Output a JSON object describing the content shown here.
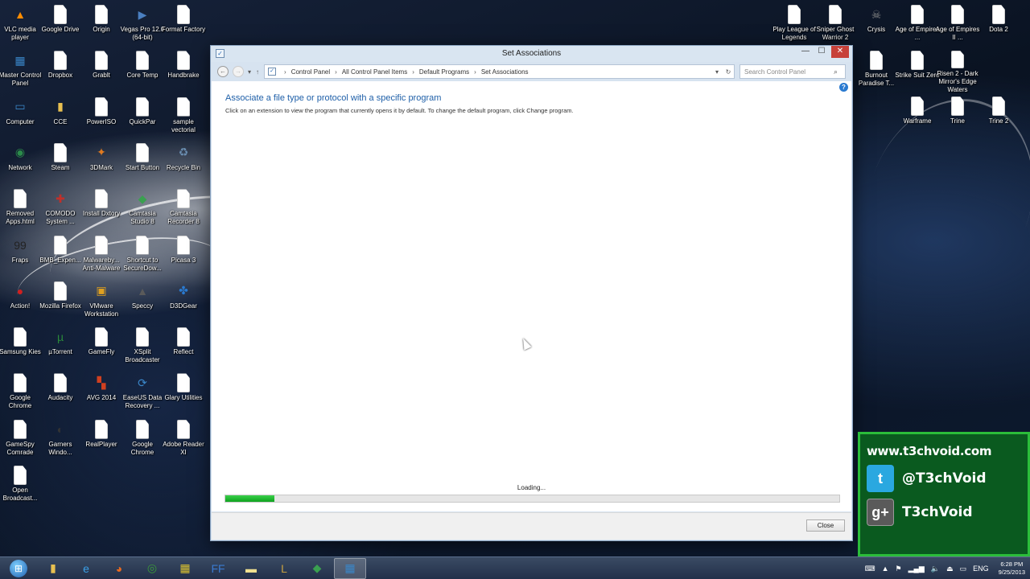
{
  "desktop": {
    "left_icons": [
      {
        "label": "VLC media player",
        "icon": "vlc-icon",
        "glyph": "▲",
        "color": "#ff8c00"
      },
      {
        "label": "Google Drive",
        "icon": "file-icon"
      },
      {
        "label": "Origin",
        "icon": "file-icon"
      },
      {
        "label": "Vegas Pro 12.0 (64-bit)",
        "icon": "vegas-icon",
        "glyph": "▶",
        "color": "#4a7fc0"
      },
      {
        "label": "Format Factory",
        "icon": "file-icon"
      },
      {
        "label": "Master Control Panel",
        "icon": "control-panel-icon",
        "glyph": "▦",
        "color": "#3a86c8"
      },
      {
        "label": "Dropbox",
        "icon": "file-icon"
      },
      {
        "label": "Grablt",
        "icon": "file-icon"
      },
      {
        "label": "Core Temp",
        "icon": "file-icon"
      },
      {
        "label": "Handbrake",
        "icon": "file-icon"
      },
      {
        "label": "Computer",
        "icon": "computer-icon",
        "glyph": "▭",
        "color": "#3a86c8"
      },
      {
        "label": "CCE",
        "icon": "folder-icon",
        "glyph": "▮",
        "color": "#e8c050"
      },
      {
        "label": "PowerISO",
        "icon": "file-icon"
      },
      {
        "label": "QuickPar",
        "icon": "file-icon"
      },
      {
        "label": "sample vectorial",
        "icon": "file-icon"
      },
      {
        "label": "Network",
        "icon": "network-icon",
        "glyph": "◉",
        "color": "#2b8a4a"
      },
      {
        "label": "Steam",
        "icon": "file-icon"
      },
      {
        "label": "3DMark",
        "icon": "3dmark-icon",
        "glyph": "✦",
        "color": "#e07a20"
      },
      {
        "label": "Start Button",
        "icon": "file-icon"
      },
      {
        "label": "Recycle Bin",
        "icon": "recycle-bin-icon",
        "glyph": "♻",
        "color": "#6a8db0"
      },
      {
        "label": "Removed Apps.html",
        "icon": "file-icon"
      },
      {
        "label": "COMODO System ...",
        "icon": "comodo-icon",
        "glyph": "✚",
        "color": "#c0302a"
      },
      {
        "label": "Install Dxtory",
        "icon": "file-icon"
      },
      {
        "label": "Camtasia Studio 8",
        "icon": "camtasia-icon",
        "glyph": "◆",
        "color": "#3aa050"
      },
      {
        "label": "Camtasia Recorder 8",
        "icon": "file-icon"
      },
      {
        "label": "Fraps",
        "icon": "fraps-icon",
        "glyph": "99",
        "color": "#222222"
      },
      {
        "label": "BMB_Expen...",
        "icon": "file-icon"
      },
      {
        "label": "Malwareby... Anti-Malware",
        "icon": "file-icon"
      },
      {
        "label": "Shortcut to SecureDow...",
        "icon": "file-icon"
      },
      {
        "label": "Picasa 3",
        "icon": "file-icon"
      },
      {
        "label": "Action!",
        "icon": "action-icon",
        "glyph": "●",
        "color": "#d02020"
      },
      {
        "label": "Mozilla Firefox",
        "icon": "file-icon"
      },
      {
        "label": "VMware Workstation",
        "icon": "vmware-icon",
        "glyph": "▣",
        "color": "#e0a020"
      },
      {
        "label": "Speccy",
        "icon": "speccy-icon",
        "glyph": "▲",
        "color": "#5a5a5a"
      },
      {
        "label": "D3DGear",
        "icon": "d3dgear-icon",
        "glyph": "✤",
        "color": "#2a7ad0"
      },
      {
        "label": "Samsung Kies",
        "icon": "file-icon"
      },
      {
        "label": "µTorrent",
        "icon": "utorrent-icon",
        "glyph": "µ",
        "color": "#2a8a3a"
      },
      {
        "label": "GameFly",
        "icon": "file-icon"
      },
      {
        "label": "XSplit Broadcaster",
        "icon": "file-icon"
      },
      {
        "label": "Reflect",
        "icon": "file-icon"
      },
      {
        "label": "Google Chrome",
        "icon": "file-icon"
      },
      {
        "label": "Audacity",
        "icon": "file-icon"
      },
      {
        "label": "AVG 2014",
        "icon": "avg-icon",
        "glyph": "▚",
        "color": "#d04020"
      },
      {
        "label": "EaseUS Data Recovery ...",
        "icon": "easeus-icon",
        "glyph": "⟳",
        "color": "#3a86c8"
      },
      {
        "label": "Glary Utilities",
        "icon": "file-icon"
      },
      {
        "label": "GameSpy Comrade",
        "icon": "file-icon"
      },
      {
        "label": "Garners Windo...",
        "icon": "gamers-icon",
        "glyph": "◐",
        "color": "#333333"
      },
      {
        "label": "RealPlayer",
        "icon": "file-icon"
      },
      {
        "label": "Google Chrome",
        "icon": "file-icon"
      },
      {
        "label": "Adobe Reader XI",
        "icon": "file-icon"
      },
      {
        "label": "Open Broadcast...",
        "icon": "file-icon"
      }
    ],
    "right_icons": [
      {
        "label": "Play League of Legends",
        "icon": "file-icon"
      },
      {
        "label": "Sniper Ghost Warrior 2",
        "icon": "file-icon"
      },
      {
        "label": "Crysis",
        "icon": "crysis-icon",
        "glyph": "☠",
        "color": "#888888"
      },
      {
        "label": "Age of Empires ...",
        "icon": "file-icon"
      },
      {
        "label": "Age of Empires II ...",
        "icon": "file-icon"
      },
      {
        "label": "Dota 2",
        "icon": "file-icon"
      },
      {
        "label": "Burnout Paradise T...",
        "icon": "file-icon"
      },
      {
        "label": "Strike Suit Zero",
        "icon": "file-icon"
      },
      {
        "label": "Risen 2 - Dark Mirror's Edge Waters",
        "icon": "file-icon"
      },
      {
        "label": "Warframe",
        "icon": "file-icon"
      },
      {
        "label": "Trine",
        "icon": "file-icon"
      },
      {
        "label": "Trine 2",
        "icon": "file-icon"
      }
    ]
  },
  "window": {
    "title": "Set Associations",
    "controls": {
      "minimize": "—",
      "maximize": "☐",
      "close": "✕"
    },
    "address": {
      "crumbs": [
        "Control Panel",
        "All Control Panel Items",
        "Default Programs",
        "Set Associations"
      ],
      "separator": "›"
    },
    "search": {
      "placeholder": "Search Control Panel"
    },
    "heading": "Associate a file type or protocol with a specific program",
    "description": "Click on an extension to view the program that currently opens it by default. To change the default program, click Change program.",
    "loading_text": "Loading...",
    "progress": 0.08,
    "close_button": "Close"
  },
  "social": {
    "site": "www.t3chvoid.com",
    "twitter": "@T3chVoid",
    "gplus": "T3chVoid"
  },
  "taskbar": {
    "pinned": [
      {
        "name": "file-explorer",
        "icon": "folder-icon",
        "glyph": "▮",
        "color": "#e8c050"
      },
      {
        "name": "internet-explorer",
        "icon": "ie-icon",
        "glyph": "e",
        "color": "#3aa0e8"
      },
      {
        "name": "firefox",
        "icon": "firefox-icon",
        "glyph": "◕",
        "color": "#e86a20"
      },
      {
        "name": "chrome",
        "icon": "chrome-icon",
        "glyph": "◎",
        "color": "#3a9a3a"
      },
      {
        "name": "app",
        "icon": "app-icon",
        "glyph": "▦",
        "color": "#d8c030"
      },
      {
        "name": "format-factory",
        "icon": "ff-icon",
        "glyph": "FF",
        "color": "#3a7ad0"
      },
      {
        "name": "notes",
        "icon": "notes-icon",
        "glyph": "▬",
        "color": "#f0e090"
      },
      {
        "name": "league",
        "icon": "league-icon",
        "glyph": "L",
        "color": "#c8a040"
      },
      {
        "name": "camtasia",
        "icon": "camtasia-icon",
        "glyph": "◆",
        "color": "#3aa050"
      },
      {
        "name": "control-panel",
        "icon": "control-panel-icon",
        "glyph": "▦",
        "color": "#3a86c8"
      }
    ],
    "language": "ENG",
    "time": "6:28 PM",
    "date": "9/25/2013"
  }
}
